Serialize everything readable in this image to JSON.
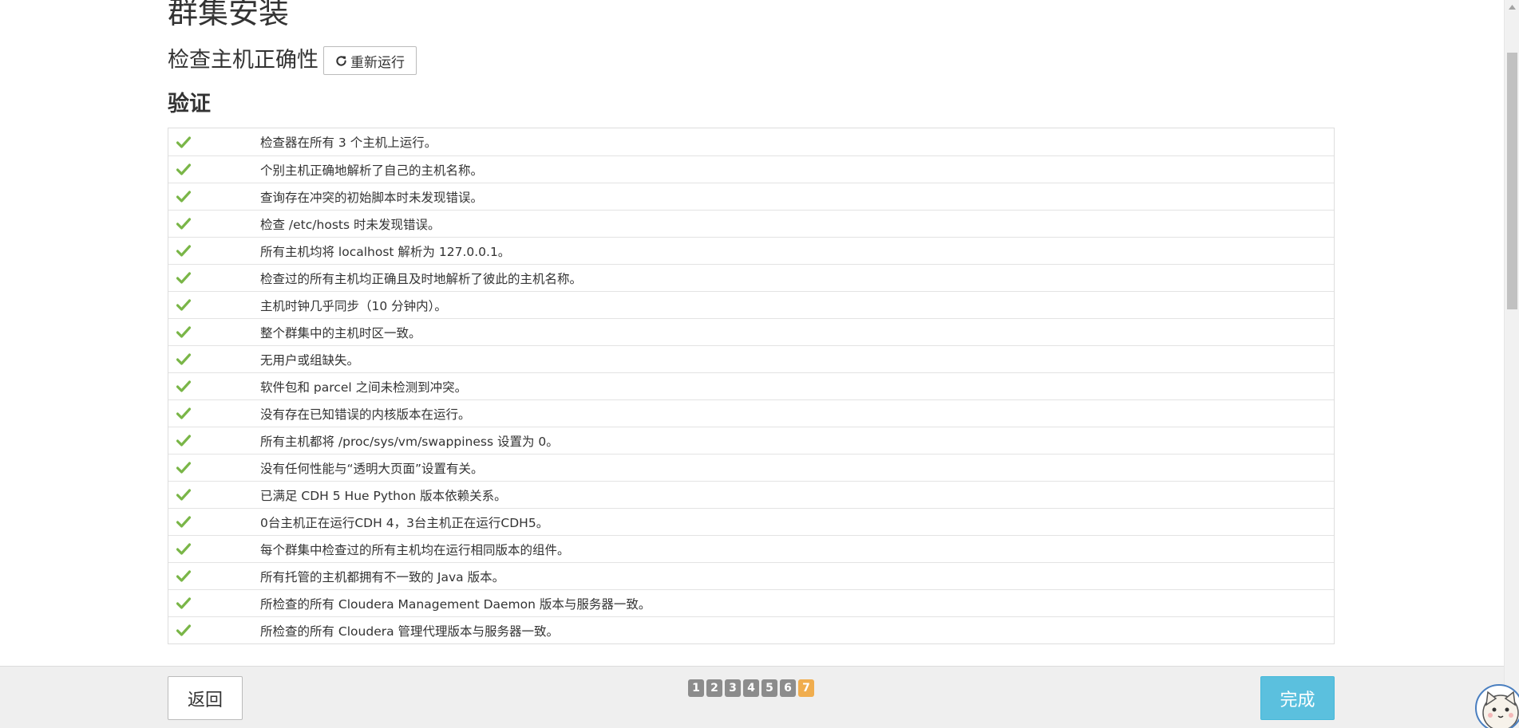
{
  "page": {
    "title": "群集安装",
    "section_title": "检查主机正确性",
    "rerun_label": "重新运行",
    "verify_title": "验证"
  },
  "checks": [
    "检查器在所有 3 个主机上运行。",
    "个别主机正确地解析了自己的主机名称。",
    "查询存在冲突的初始脚本时未发现错误。",
    "检查 /etc/hosts 时未发现错误。",
    "所有主机均将 localhost 解析为 127.0.0.1。",
    "检查过的所有主机均正确且及时地解析了彼此的主机名称。",
    "主机时钟几乎同步（10 分钟内）。",
    "整个群集中的主机时区一致。",
    "无用户或组缺失。",
    "软件包和 parcel 之间未检测到冲突。",
    "没有存在已知错误的内核版本在运行。",
    "所有主机都将 /proc/sys/vm/swappiness 设置为 0。",
    "没有任何性能与“透明大页面”设置有关。",
    "已满足 CDH 5 Hue Python 版本依赖关系。",
    "0台主机正在运行CDH 4，3台主机正在运行CDH5。",
    "每个群集中检查过的所有主机均在运行相同版本的组件。",
    "所有托管的主机都拥有不一致的 Java 版本。",
    "所检查的所有 Cloudera Management Daemon 版本与服务器一致。",
    "所检查的所有 Cloudera 管理代理版本与服务器一致。"
  ],
  "footer": {
    "back_label": "返回",
    "finish_label": "完成",
    "steps": [
      "1",
      "2",
      "3",
      "4",
      "5",
      "6",
      "7"
    ],
    "active_step": "7"
  },
  "colors": {
    "check_green": "#7ab648",
    "finish_blue": "#5bc0de",
    "active_step": "#f0ad4e",
    "inactive_step": "#8c8c8c"
  },
  "icons": {
    "rerun": "refresh-icon",
    "check": "checkmark-icon"
  }
}
